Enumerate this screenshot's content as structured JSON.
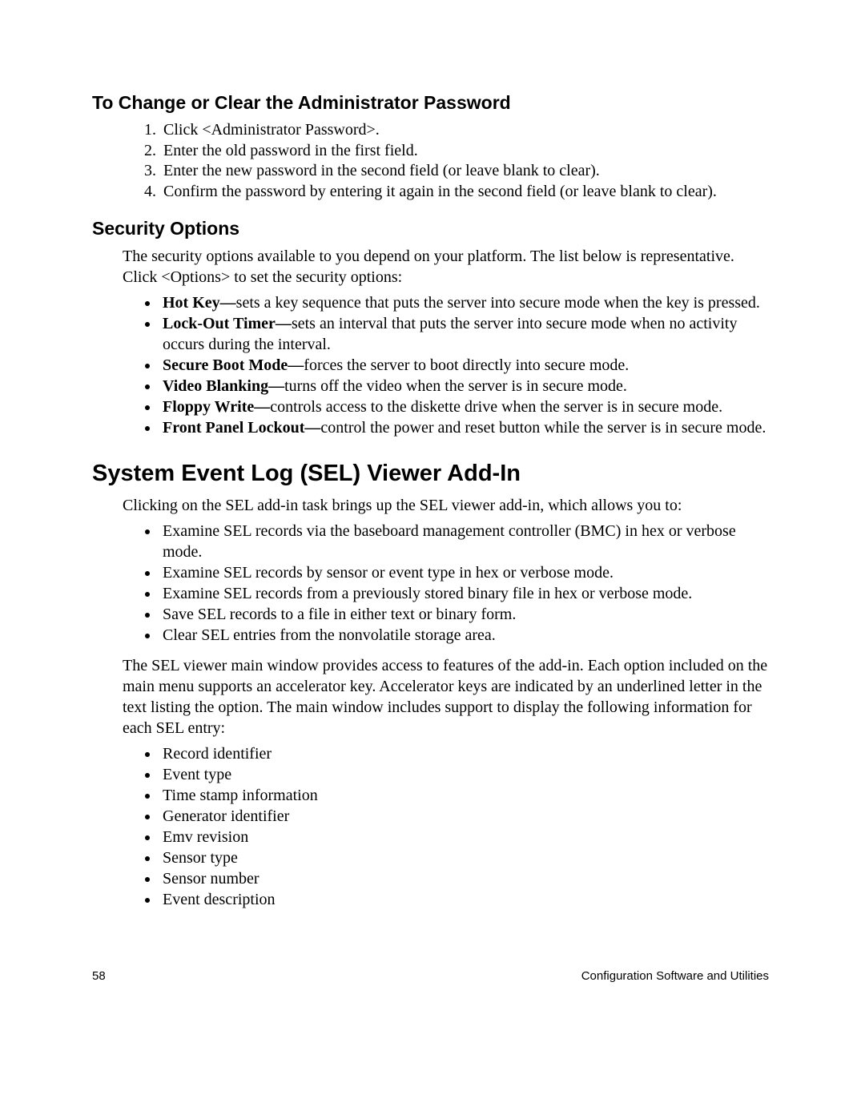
{
  "section1": {
    "heading": "To Change or Clear the Administrator Password",
    "steps": [
      "Click <Administrator Password>.",
      "Enter the old password in the first field.",
      "Enter the new password in the second field (or leave blank to clear).",
      "Confirm the password by entering it again in the second field (or leave blank to clear)."
    ]
  },
  "section2": {
    "heading": "Security Options",
    "intro": "The security options available to you depend on your platform.  The list below is representative. Click <Options> to set the security options:",
    "bullets": [
      {
        "lead": "Hot Key—",
        "text": "sets a key sequence that puts the server into secure mode when the key is pressed."
      },
      {
        "lead": "Lock-Out Timer—",
        "text": "sets an interval that puts the server into secure mode when no activity occurs during the interval."
      },
      {
        "lead": "Secure Boot Mode—",
        "text": "forces the server to boot directly into secure mode."
      },
      {
        "lead": "Video Blanking—",
        "text": "turns off the video when the server is in secure mode."
      },
      {
        "lead": "Floppy Write—",
        "text": "controls access to the diskette drive when the server is in secure mode."
      },
      {
        "lead": "Front Panel Lockout—",
        "text": "control the power and reset button while the server is in secure mode."
      }
    ]
  },
  "section3": {
    "heading": "System Event Log (SEL) Viewer Add-In",
    "intro": "Clicking on the SEL add-in task brings up the SEL viewer add-in, which allows you to:",
    "bullets1": [
      "Examine SEL records via the baseboard management controller (BMC) in hex or verbose mode.",
      "Examine SEL records by sensor or event type in hex or verbose mode.",
      "Examine SEL records from a previously stored binary file in hex or verbose mode.",
      "Save SEL records to a file in either text or binary form.",
      "Clear SEL entries from the nonvolatile storage area."
    ],
    "para2": "The SEL viewer main window provides access to features of the add-in.  Each option included on the main menu supports an accelerator key.  Accelerator keys are indicated by an underlined letter in the text listing the option.  The main window includes support to display the following information for each SEL entry:",
    "bullets2": [
      "Record identifier",
      "Event type",
      "Time stamp information",
      "Generator identifier",
      "Emv revision",
      "Sensor type",
      "Sensor number",
      "Event description"
    ]
  },
  "footer": {
    "page": "58",
    "title": "Configuration Software and Utilities"
  }
}
